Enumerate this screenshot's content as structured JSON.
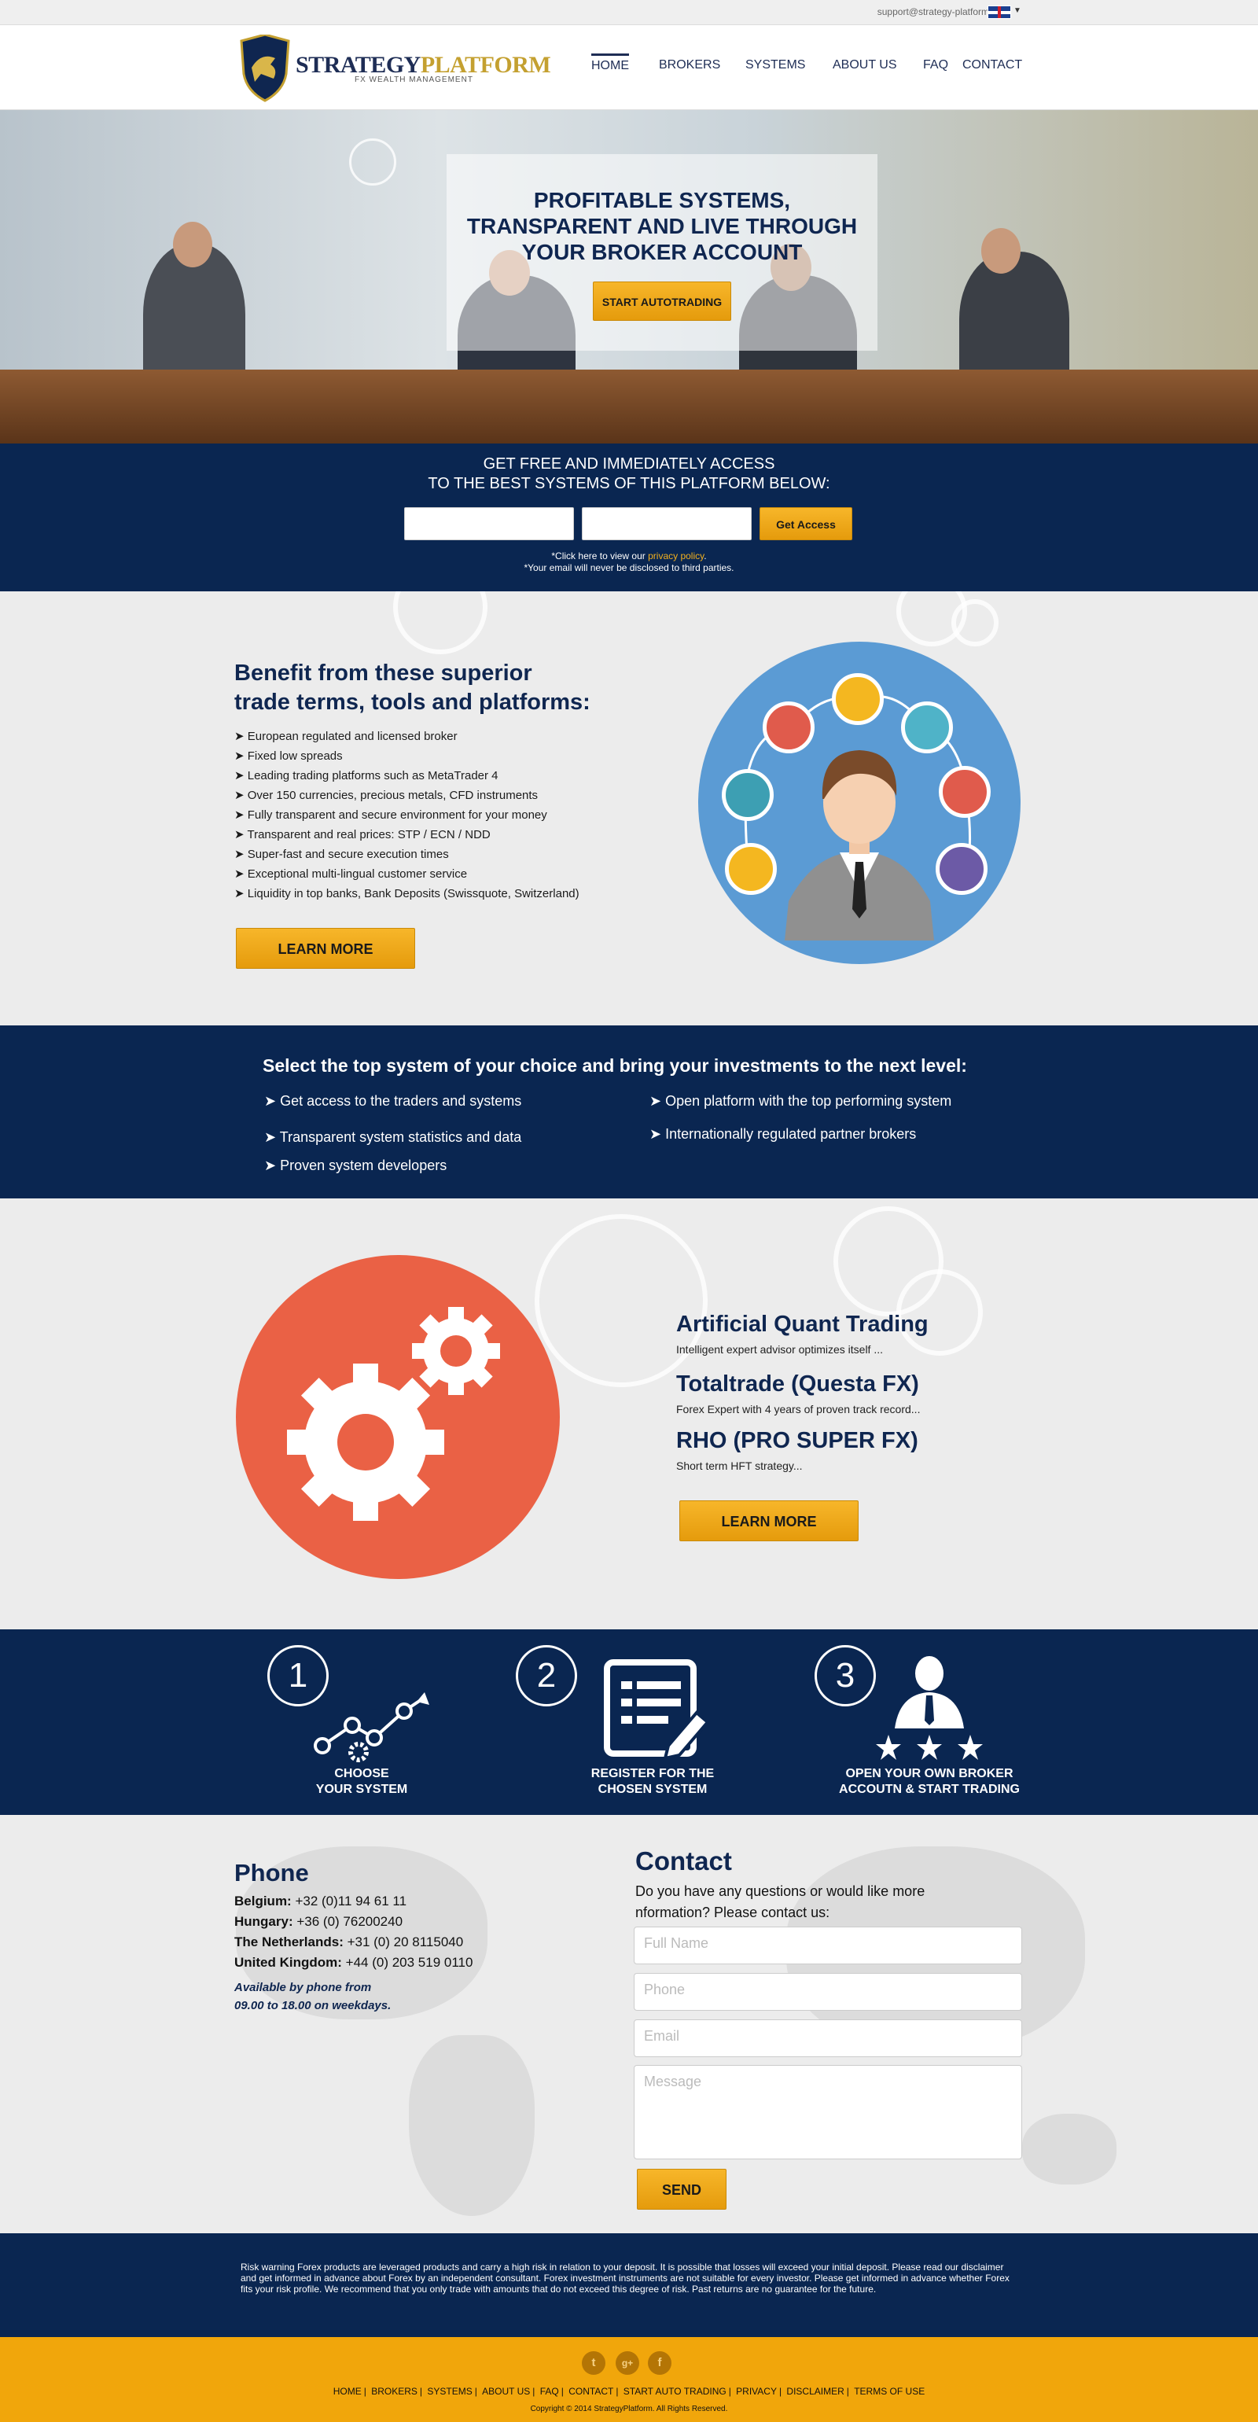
{
  "topbar": {
    "email": "support@strategy-platform.com"
  },
  "header": {
    "logo_part1": "STRATEGY",
    "logo_part2": "PLATFORM",
    "logo_sub": "FX WEALTH MANAGEMENT",
    "nav": [
      "HOME",
      "BROKERS",
      "SYSTEMS",
      "ABOUT US",
      "FAQ",
      "CONTACT"
    ]
  },
  "hero": {
    "title_line1": "PROFITABLE SYSTEMS,",
    "title_line2": "TRANSPARENT AND LIVE  THROUGH",
    "title_line3": "YOUR BROKER ACCOUNT",
    "button": "START AUTOTRADING"
  },
  "signup": {
    "line1": "GET FREE AND IMMEDIATELY ACCESS",
    "line2": "TO THE BEST SYSTEMS OF THIS PLATFORM BELOW:",
    "button": "Get Access",
    "note1_pre": "*Click here to view our ",
    "note1_link": "privacy policy",
    "note1_post": ".",
    "note2": "*Your email will never be disclosed to third parties."
  },
  "benefits": {
    "title_line1": "Benefit from these superior",
    "title_line2": "trade terms, tools and platforms:",
    "items": [
      "European regulated and licensed broker",
      "Fixed low spreads",
      "Leading trading platforms such as MetaTrader 4",
      "Over 150 currencies, precious metals, CFD instruments",
      "Fully transparent and secure environment for your money",
      "Transparent and real prices: STP / ECN / NDD",
      "Super-fast and secure execution times",
      "Exceptional multi-lingual customer service",
      "Liquidity in top banks, Bank Deposits (Swissquote, Switzerland)"
    ],
    "button": "LEARN MORE",
    "bullet": "➤"
  },
  "select": {
    "title": "Select the top system of your choice and bring  your investments to the next level:",
    "left": [
      "Get access to the traders and systems",
      "Transparent system statistics and data",
      "Proven system developers"
    ],
    "right": [
      "Open platform with the top performing system",
      "Internationally regulated partner brokers"
    ]
  },
  "systems": {
    "items": [
      {
        "name": "Artificial Quant Trading",
        "desc": "Intelligent expert advisor optimizes itself ..."
      },
      {
        "name": "Totaltrade (Questa FX)",
        "desc": "Forex Expert with 4 years of proven track record..."
      },
      {
        "name": "RHO (PRO SUPER FX)",
        "desc": "Short term HFT strategy..."
      }
    ],
    "button": "LEARN MORE"
  },
  "steps": [
    {
      "num": "1",
      "line1": "CHOOSE",
      "line2": "YOUR SYSTEM"
    },
    {
      "num": "2",
      "line1": "REGISTER FOR THE",
      "line2": "CHOSEN SYSTEM"
    },
    {
      "num": "3",
      "line1": "OPEN YOUR OWN BROKER",
      "line2": "ACCOUTN & START TRADING"
    }
  ],
  "phone": {
    "title": "Phone",
    "rows": [
      {
        "country": "Belgium:",
        "number": " +32 (0)11 94 61 11"
      },
      {
        "country": "Hungary:",
        "number": " +36 (0) 76200240"
      },
      {
        "country": "The Netherlands:",
        "number": " +31 (0) 20 8115040"
      },
      {
        "country": "United Kingdom:",
        "number": " +44 (0) 203 519 0110"
      }
    ],
    "avail1": "Available by phone from",
    "avail2": "09.00 to 18.00 on weekdays."
  },
  "contact": {
    "title": "Contact",
    "text1": "Do you have any questions or would like more",
    "text2": "nformation? Please contact us:",
    "ph_name": "Full Name",
    "ph_phone": "Phone",
    "ph_email": "Email",
    "ph_message": "Message",
    "send": "SEND"
  },
  "risk": "Risk warning Forex products are leveraged products and carry a high risk in relation to your deposit.  It is possible that losses will exceed your initial deposit. Please read our disclaimer and get informed in advance  about Forex by an independent consultant. Forex investment instruments are not suitable for every investor. Please get  informed in advance whether Forex fits your risk profile. We recommend that you only trade with amounts that do not exceed this degree of risk. Past returns are no guarantee for the  future.",
  "footer": {
    "social": [
      "t",
      "g+",
      "f"
    ],
    "links": [
      "HOME",
      "BROKERS",
      "SYSTEMS",
      "ABOUT US",
      "FAQ",
      "CONTACT",
      "START AUTO TRADING",
      "PRIVACY",
      "DISCLAIMER",
      "TERMS OF USE"
    ],
    "copyright": "Copyright © 2014 StrategyPlatform. All Rights Reserved."
  },
  "colors": {
    "navy": "#0a2651",
    "gold": "#f2a90f",
    "orange": "#ea6145",
    "blue": "#5b9bd4"
  }
}
